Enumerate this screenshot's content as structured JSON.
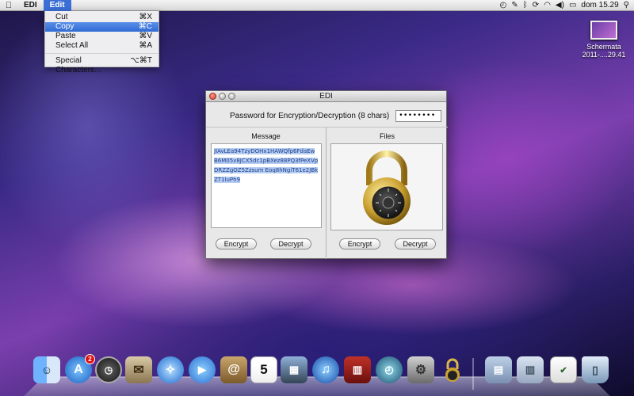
{
  "menubar": {
    "app_name": "EDI",
    "active_menu": "Edit",
    "clock": "dom 15.29"
  },
  "edit_menu": {
    "items": [
      {
        "label": "Cut",
        "shortcut": "⌘X"
      },
      {
        "label": "Copy",
        "shortcut": "⌘C"
      },
      {
        "label": "Paste",
        "shortcut": "⌘V"
      },
      {
        "label": "Select All",
        "shortcut": "⌘A"
      },
      {
        "label": "Special Characters…",
        "shortcut": "⌥⌘T"
      }
    ],
    "highlighted": "Copy"
  },
  "desktop": {
    "icon_label_line1": "Schermata",
    "icon_label_line2": "2011-....29.41"
  },
  "window": {
    "title": "EDI",
    "password_label": "Password for Encryption/Decryption (8 chars)",
    "password_value": "••••••••",
    "message_title": "Message",
    "message_text": "JIAvLEa94TzyDOHx1HAWQfp6FdaEwB6M05v8JCX5dc1pBXez88PQ3fPeXVpDRZZgOZ5Zzsum Eoq8hNgiT61e2JBkZT1luPh9",
    "files_title": "Files",
    "encrypt_label": "Encrypt",
    "decrypt_label": "Decrypt"
  },
  "dock": {
    "app_store_badge": "2"
  },
  "colors": {
    "menu_highlight": "#2f6bd4",
    "selection": "#b6cdf2",
    "close_button": "#d63a2a"
  }
}
